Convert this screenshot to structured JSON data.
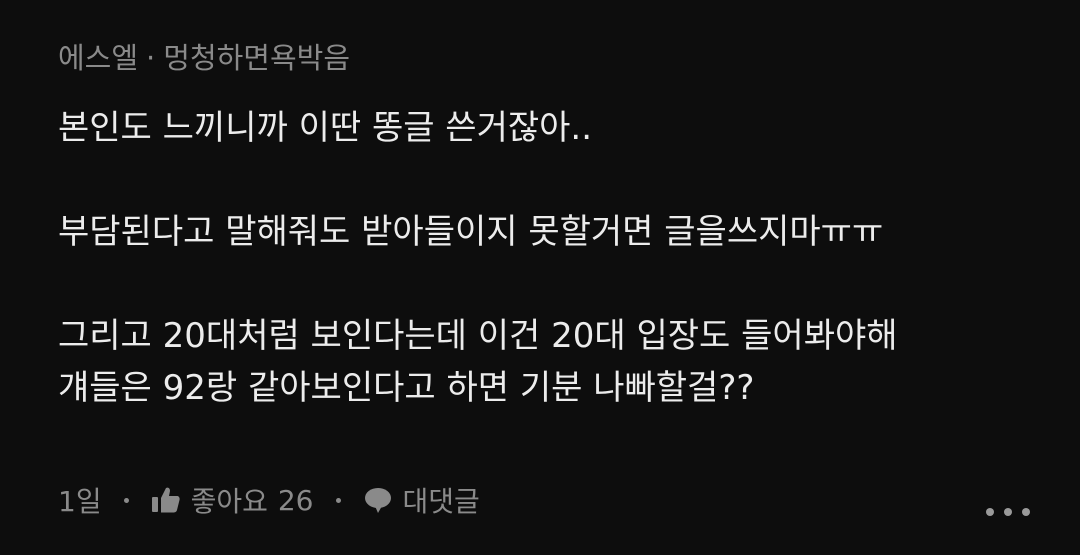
{
  "comment": {
    "author": "에스엘",
    "separator": "·",
    "nickname": "멍청하면욕박음",
    "lines": [
      "본인도 느끼니까 이딴 똥글 쓴거잖아..",
      "",
      "부담된다고 말해줘도 받아들이지 못할거면 글을쓰지마ㅠㅠ",
      "",
      "그리고 20대처럼 보인다는데 이건 20대 입장도 들어봐야해",
      "걔들은 92랑 같아보인다고 하면 기분 나빠할걸??"
    ],
    "time": "1일",
    "like_label": "좋아요",
    "like_count": "26",
    "reply_label": "대댓글"
  },
  "icons": {
    "like": "thumbs-up-icon",
    "reply": "speech-bubble-icon",
    "more": "more-horizontal-icon"
  },
  "colors": {
    "background": "#0d0d0d",
    "text": "#ececec",
    "muted": "#8a8a8a"
  }
}
